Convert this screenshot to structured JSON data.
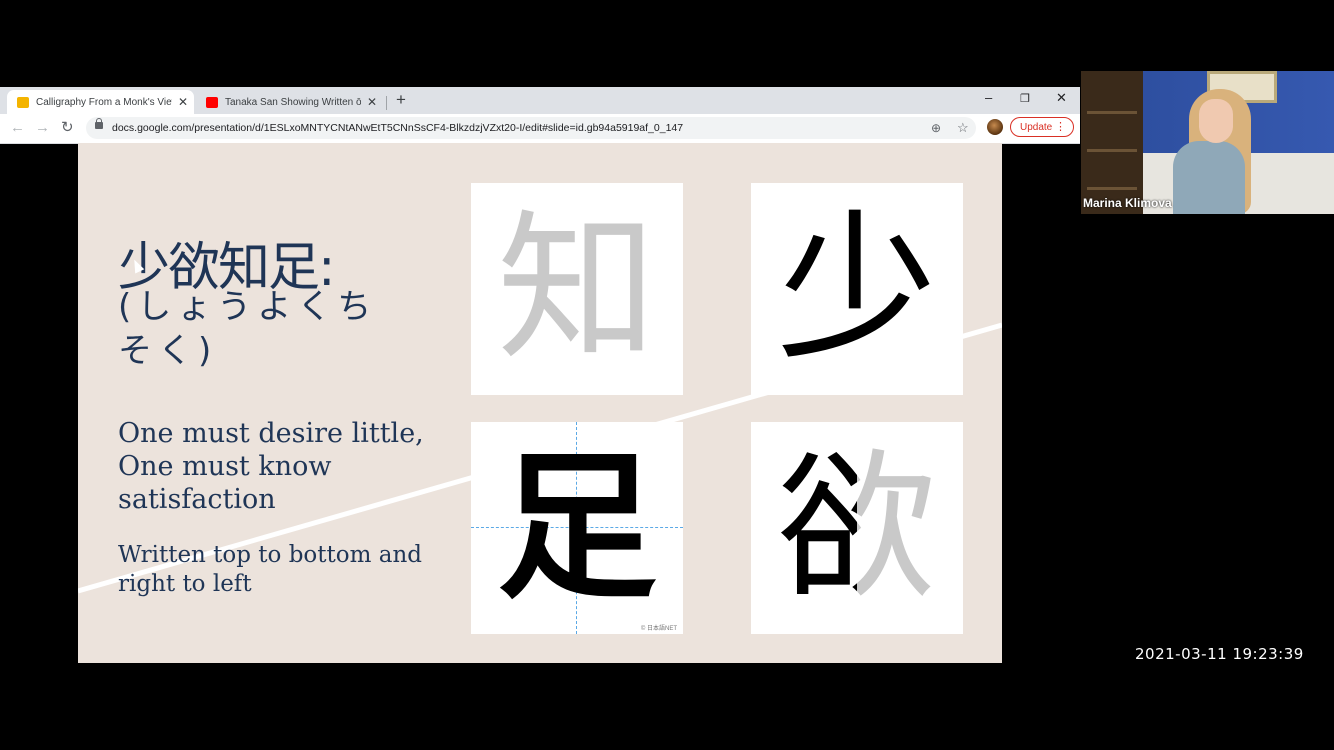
{
  "browser": {
    "tabs": [
      {
        "title": "Calligraphy From a Monk's View",
        "favicon": "google-slides-icon",
        "active": true
      },
      {
        "title": "Tanaka San Showing Written ōkyo",
        "favicon": "youtube-icon",
        "active": false
      }
    ],
    "new_tab_symbol": "+",
    "window_controls": {
      "minimize": "–",
      "restore": "❐",
      "close": "✕"
    },
    "address": {
      "url": "docs.google.com/presentation/d/1ESLxoMNTYCNtANwEtT5CNnSsCF4-BlkzdzjVZxt20-I/edit#slide=id.gb94a5919af_0_147"
    },
    "update_label": "Update",
    "colors": {
      "tabbar": "#dee1e6",
      "update": "#d93025"
    }
  },
  "slide": {
    "title_kanji": "少欲知足:",
    "reading": "(しょうよくちそく)",
    "meaning": "One must desire little, One must know satisfaction",
    "note": "Written top to bottom and right to left",
    "cards": [
      {
        "glyph": "知",
        "style": "gray"
      },
      {
        "glyph": "少",
        "style": "black"
      },
      {
        "glyph": "足",
        "style": "black",
        "credit": "© 日本語NET"
      },
      {
        "glyph": "欲",
        "style": "partial"
      }
    ],
    "colors": {
      "background": "#ece3dc",
      "text": "#1f3556"
    }
  },
  "webcam": {
    "name": "Marina Klimova"
  },
  "timestamp": "2021-03-11  19:23:39"
}
